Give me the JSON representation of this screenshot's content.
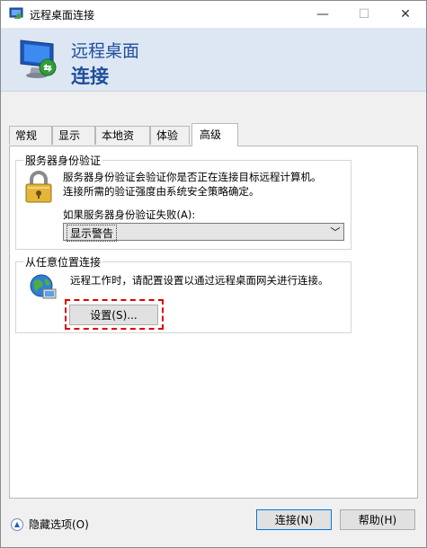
{
  "window": {
    "title": "远程桌面连接",
    "minimize_glyph": "—",
    "maximize_glyph": "☐",
    "close_glyph": "✕"
  },
  "banner": {
    "line1": "远程桌面",
    "line2": "连接"
  },
  "tabs": [
    {
      "label": "常规"
    },
    {
      "label": "显示"
    },
    {
      "label": "本地资源"
    },
    {
      "label": "体验"
    },
    {
      "label": "高级",
      "active": true
    }
  ],
  "auth": {
    "title": "服务器身份验证",
    "description_line1": "服务器身份验证会验证你是否正在连接目标远程计算机。",
    "description_line2": "连接所需的验证强度由系统安全策略确定。",
    "fail_label": "如果服务器身份验证失败(A):",
    "fail_value": "显示警告"
  },
  "anywhere": {
    "title": "从任意位置连接",
    "description": "远程工作时，请配置设置以通过远程桌面网关进行连接。",
    "settings_label": "设置(S)..."
  },
  "footer": {
    "hide_options_label": "隐藏选项(O)",
    "connect_label": "连接(N)",
    "help_label": "帮助(H)"
  },
  "icons": {
    "app": "remote-desktop-icon",
    "banner": "remote-desktop-monitor-icon",
    "lock": "padlock-icon",
    "gateway": "globe-network-icon"
  },
  "colors": {
    "accent": "#1f4e9b",
    "highlight": "#e00000",
    "button_focus": "#0078d7"
  }
}
